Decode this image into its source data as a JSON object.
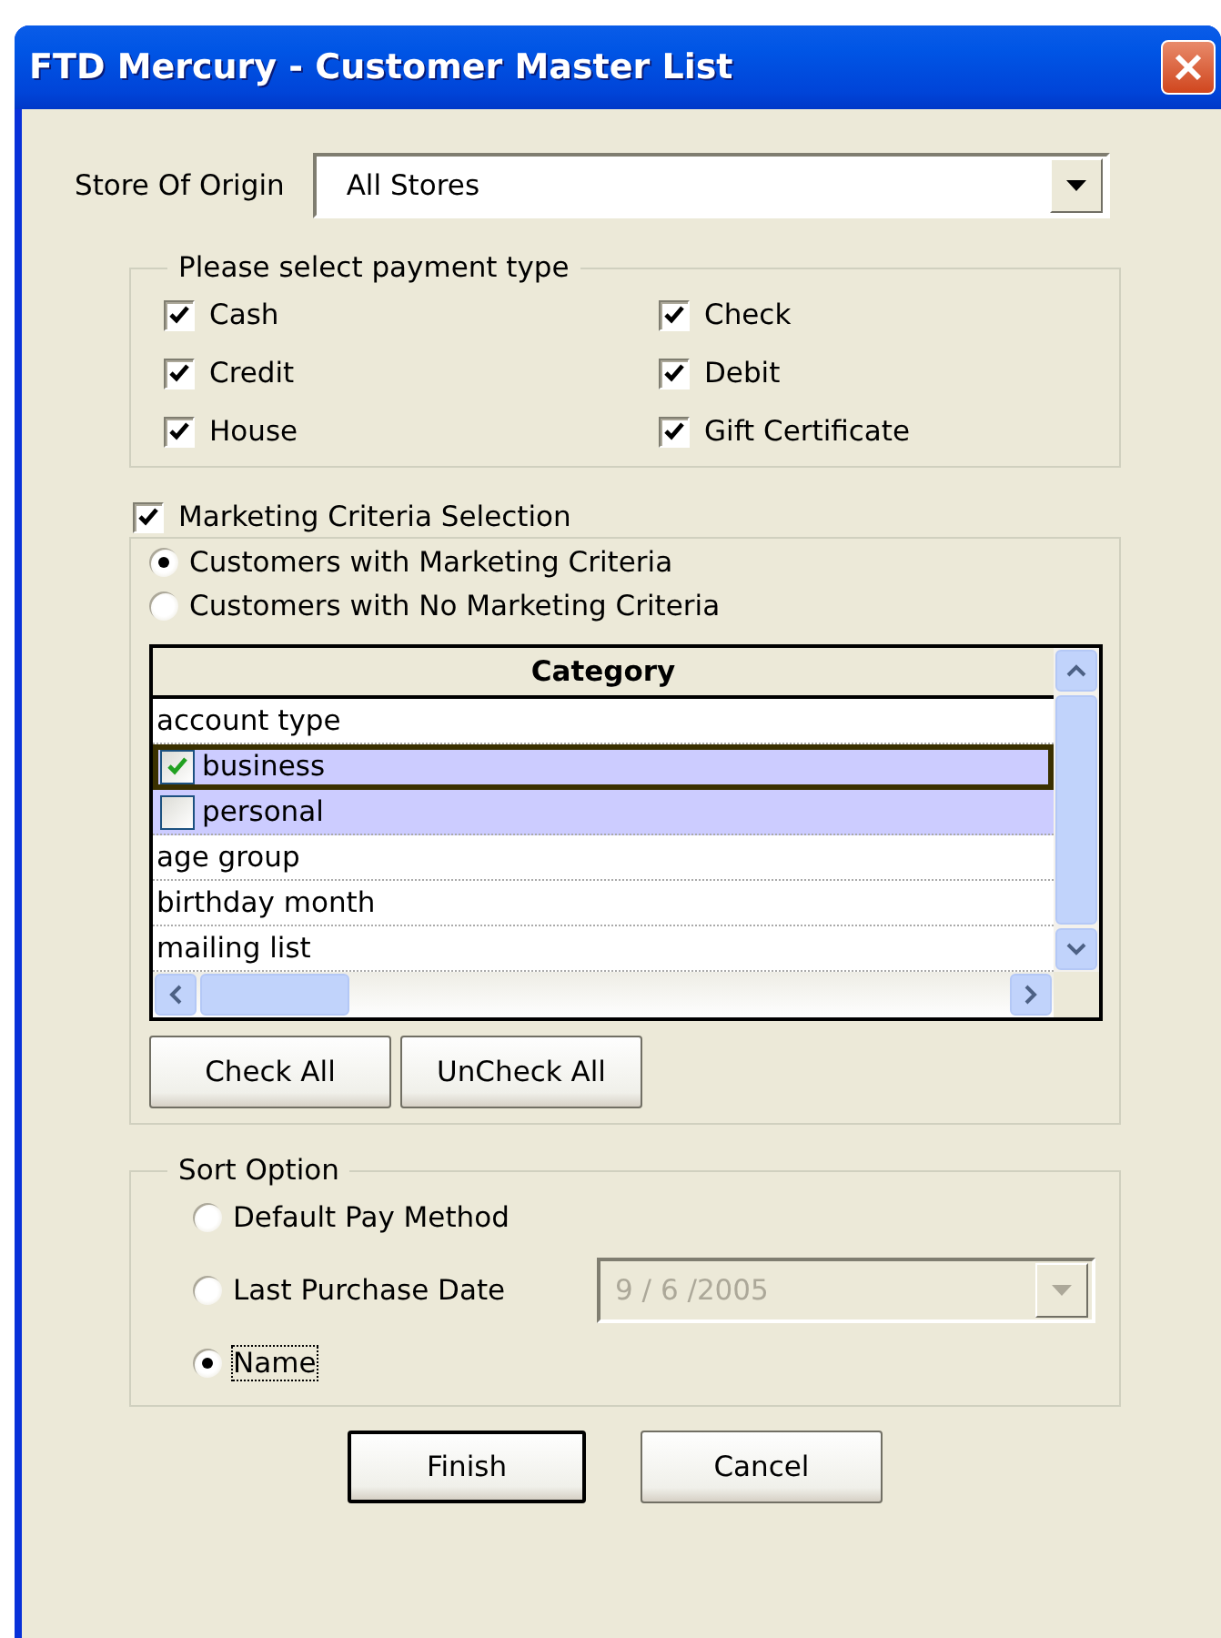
{
  "window": {
    "title": "FTD Mercury - Customer Master List"
  },
  "store": {
    "label": "Store Of Origin",
    "value": "All Stores"
  },
  "payment": {
    "title": "Please select payment type",
    "options": [
      {
        "label": "Cash",
        "checked": true
      },
      {
        "label": "Check",
        "checked": true
      },
      {
        "label": "Credit",
        "checked": true
      },
      {
        "label": "Debit",
        "checked": true
      },
      {
        "label": "House",
        "checked": true
      },
      {
        "label": "Gift Certificate",
        "checked": true
      }
    ]
  },
  "marketing": {
    "label": "Marketing Criteria Selection",
    "checked": true,
    "modes": [
      {
        "label": "Customers with Marketing Criteria",
        "selected": true
      },
      {
        "label": "Customers with No Marketing Criteria",
        "selected": false
      }
    ],
    "grid": {
      "column": "Category",
      "rows": [
        {
          "kind": "group",
          "label": "account type",
          "selected": false,
          "focused": false
        },
        {
          "kind": "item",
          "label": "business",
          "checked": true,
          "selected": true,
          "focused": true
        },
        {
          "kind": "item",
          "label": "personal",
          "checked": false,
          "selected": true,
          "focused": false
        },
        {
          "kind": "group",
          "label": "age group",
          "selected": false,
          "focused": false
        },
        {
          "kind": "group",
          "label": "birthday month",
          "selected": false,
          "focused": false
        },
        {
          "kind": "group",
          "label": "mailing list",
          "selected": false,
          "focused": false
        }
      ]
    },
    "buttons": [
      "Check All",
      "UnCheck All"
    ]
  },
  "sort": {
    "title": "Sort Option",
    "options": [
      {
        "label": "Default Pay Method",
        "selected": false
      },
      {
        "label": "Last Purchase Date",
        "selected": false,
        "date": {
          "value": "9 / 6 /2005",
          "disabled": true
        }
      },
      {
        "label": "Name",
        "selected": true
      }
    ]
  },
  "buttons": [
    "Finish",
    "Cancel"
  ]
}
